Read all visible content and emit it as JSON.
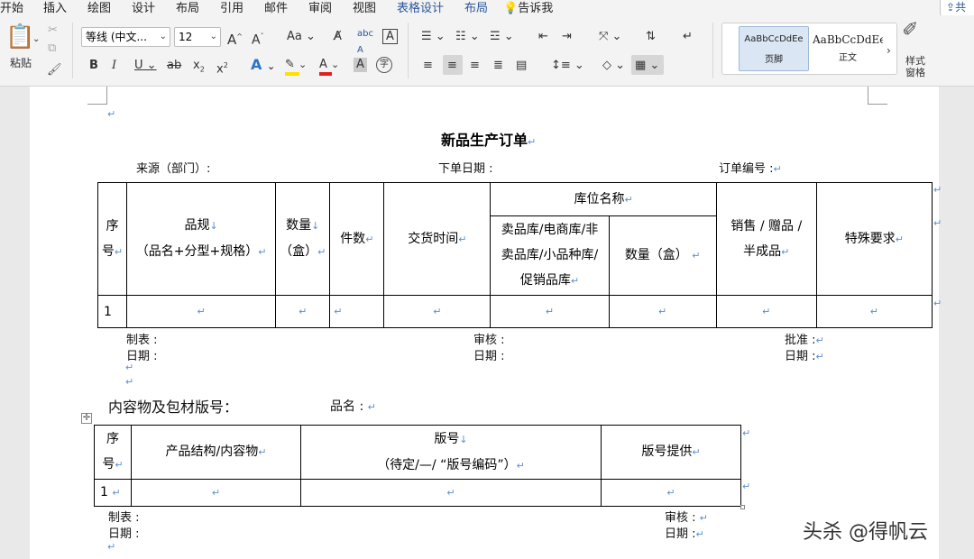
{
  "tabs": [
    {
      "label": "开始",
      "active": true
    },
    {
      "label": "插入"
    },
    {
      "label": "绘图"
    },
    {
      "label": "设计"
    },
    {
      "label": "布局"
    },
    {
      "label": "引用"
    },
    {
      "label": "邮件"
    },
    {
      "label": "审阅"
    },
    {
      "label": "视图"
    },
    {
      "label": "表格设计",
      "contextual": true
    },
    {
      "label": "布局",
      "contextual": true
    },
    {
      "label": "告诉我",
      "icon": "lightbulb-icon"
    }
  ],
  "share_label": "共",
  "ribbon": {
    "paste_label": "粘贴",
    "font_name": "等线 (中文...",
    "font_size": "12",
    "grow_font": "A",
    "shrink_font": "A",
    "change_case": "Aa",
    "bold": "B",
    "italic": "I",
    "underline": "U",
    "strikethrough": "ab",
    "subscript": "x",
    "superscript": "x",
    "text_effects": "A",
    "font_color": "A",
    "char_shading": "A",
    "enclose_char": "字",
    "styles": [
      {
        "sample": "AaBbCcDdEe",
        "name": "页脚",
        "selected": true
      },
      {
        "sample": "AaBbCcDdEe",
        "name": "正文"
      }
    ],
    "styles_pane_label_1": "样式",
    "styles_pane_label_2": "窗格",
    "colors": {
      "accent": "#2b579a",
      "font_color_bar": "#e02020",
      "highlight_bar": "#ffe000"
    }
  },
  "doc": {
    "mark": "↵",
    "title": "新品生产订单",
    "meta": {
      "source": "来源（部门）:",
      "order_date": "下单日期 :",
      "order_no": "订单编号 :"
    },
    "table1": {
      "h_seq_1": "序",
      "h_seq_2": "号",
      "h_spec_1": "品规",
      "h_spec_2": "（品名+分型+规格）",
      "h_qty_1": "数量",
      "h_qty_2": "（盒）",
      "h_pieces": "件数",
      "h_delivery": "交货时间",
      "h_location": "库位名称",
      "h_loc_1": "卖品库/电商库/非",
      "h_loc_2": "卖品库/小品种库/",
      "h_loc_3": "促销品库",
      "h_loc_qty": "数量（盒）",
      "h_sale_1": "销售 / 赠品 /",
      "h_sale_2": "半成品",
      "h_special": "特殊要求",
      "row1_seq": "1"
    },
    "sign1": {
      "maker": "制表 :",
      "date_l": "日期 :",
      "review": "审核 :",
      "date_m": "日期 :",
      "approve": "批准 :",
      "date_r": "日期 :"
    },
    "section2_title": "内容物及包材版号：",
    "product_name_label": "品名 :",
    "table2": {
      "h_seq_1": "序",
      "h_seq_2": "号",
      "h_structure": "产品结构/内容物",
      "h_version_1": "版号",
      "h_version_2": "（待定/—/ “版号编码”）",
      "h_provider": "版号提供",
      "row1_seq": "1"
    },
    "sign2": {
      "maker": "制表 :",
      "date_l": "日期 :",
      "review": "审核 :",
      "date_r": "日期 :"
    }
  },
  "watermark": "头杀 @得帆云"
}
